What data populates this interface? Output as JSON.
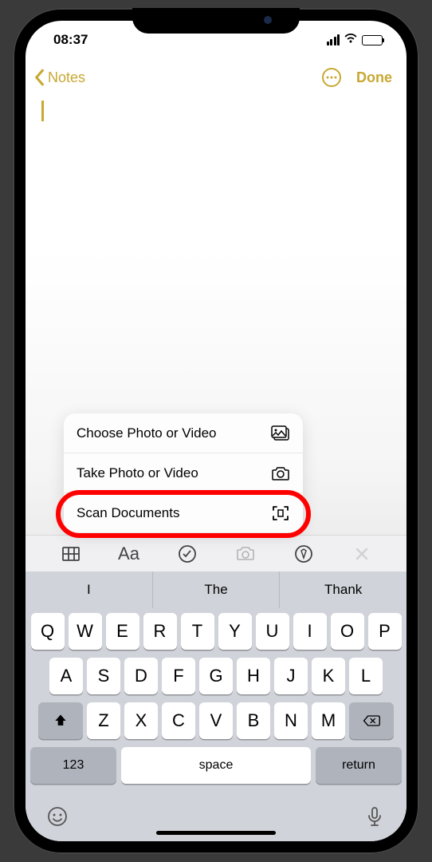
{
  "status": {
    "time": "08:37"
  },
  "nav": {
    "back_label": "Notes",
    "done_label": "Done"
  },
  "menu": {
    "items": [
      {
        "label": "Choose Photo or Video"
      },
      {
        "label": "Take Photo or Video"
      },
      {
        "label": "Scan Documents"
      }
    ]
  },
  "format_bar": {
    "aa": "Aa"
  },
  "predictions": [
    "I",
    "The",
    "Thank"
  ],
  "keyboard": {
    "row1": [
      "Q",
      "W",
      "E",
      "R",
      "T",
      "Y",
      "U",
      "I",
      "O",
      "P"
    ],
    "row2": [
      "A",
      "S",
      "D",
      "F",
      "G",
      "H",
      "J",
      "K",
      "L"
    ],
    "row3": [
      "Z",
      "X",
      "C",
      "V",
      "B",
      "N",
      "M"
    ],
    "numbers_label": "123",
    "space_label": "space",
    "return_label": "return"
  }
}
